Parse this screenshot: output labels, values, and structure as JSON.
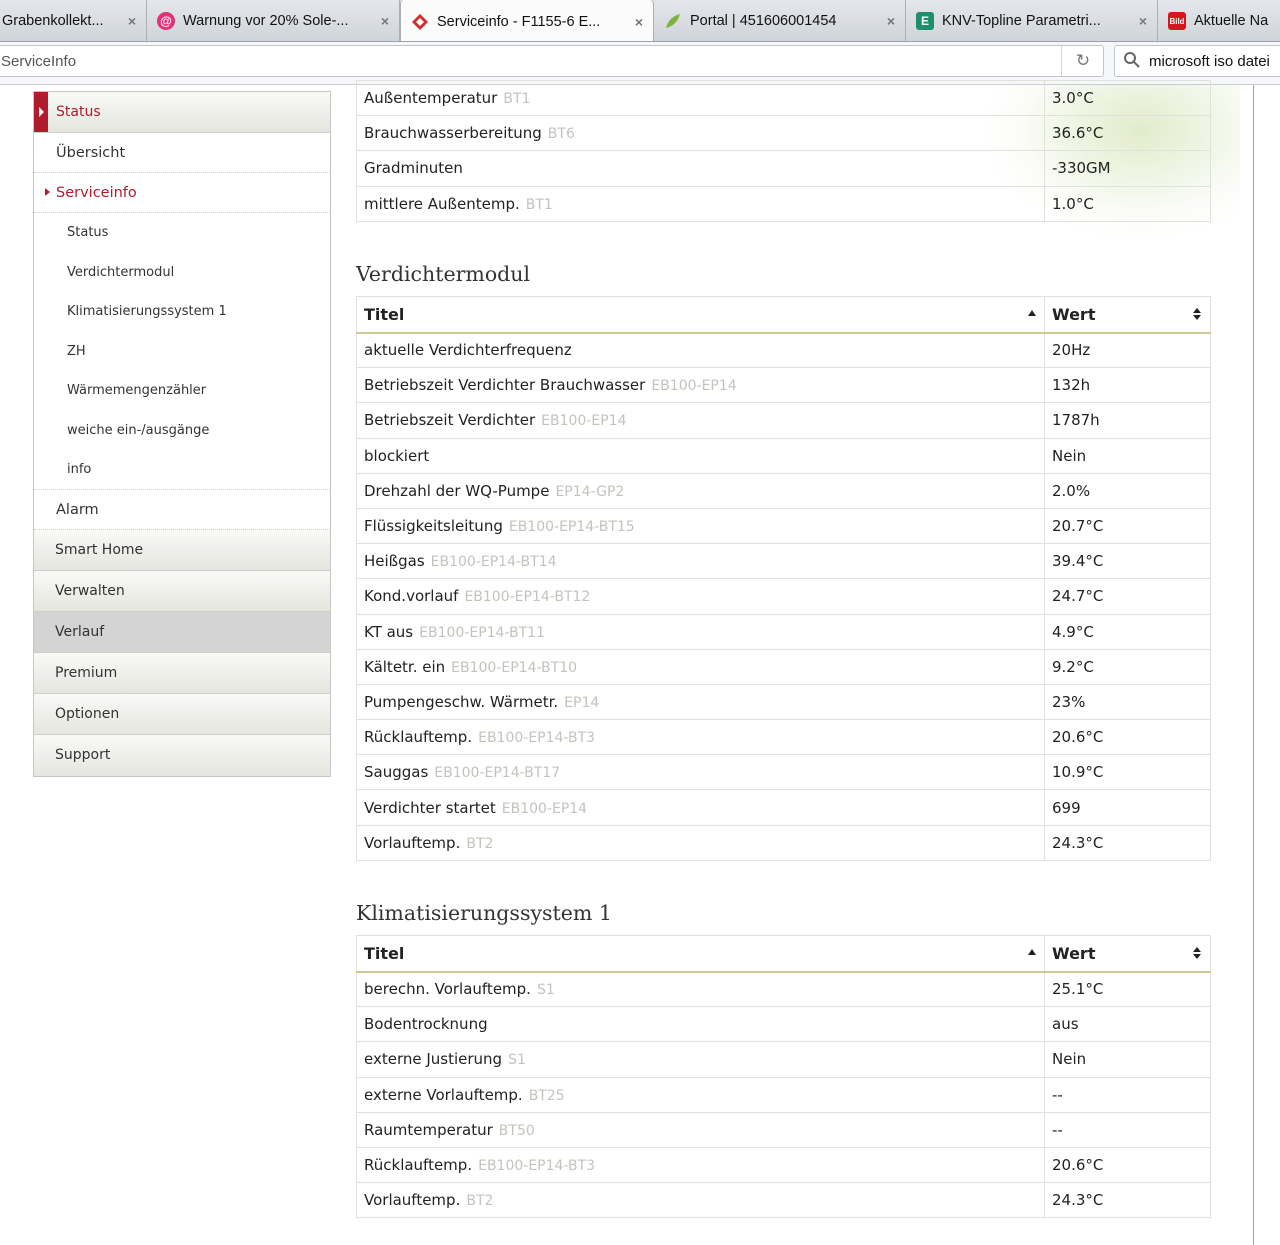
{
  "browser": {
    "tabs": [
      {
        "title": "Grabenkollekt...",
        "active": false
      },
      {
        "title": "Warnung vor 20% Sole-...",
        "active": false
      },
      {
        "title": "Serviceinfo - F1155-6 E...",
        "active": true
      },
      {
        "title": "Portal | 451606001454",
        "active": false
      },
      {
        "title": "KNV-Topline Parametri...",
        "active": false
      },
      {
        "title": "Aktuelle Na",
        "active": false
      }
    ],
    "tab_close_glyph": "×",
    "favicon_letters": {
      "knv": "E",
      "bild": "Bild"
    },
    "url": "ServiceInfo",
    "search": "microsoft iso datei"
  },
  "sidebar": {
    "status": "Status",
    "uebersicht": "Übersicht",
    "serviceinfo": "Serviceinfo",
    "sub_items": [
      "Status",
      "Verdichtermodul",
      "Klimatisierungssystem 1",
      "ZH",
      "Wärmemengenzähler",
      "weiche ein-/ausgänge",
      "info"
    ],
    "alarm": "Alarm",
    "smart_home": "Smart Home",
    "verwalten": "Verwalten",
    "verlauf": "Verlauf",
    "premium": "Premium",
    "optionen": "Optionen",
    "support": "Support"
  },
  "status_table": {
    "rows": [
      {
        "title": "Außentemperatur",
        "code": "BT1",
        "value": "3.0°C"
      },
      {
        "title": "Brauchwasserbereitung",
        "code": "BT6",
        "value": "36.6°C"
      },
      {
        "title": "Gradminuten",
        "code": "",
        "value": "-330GM"
      },
      {
        "title": "mittlere Außentemp.",
        "code": "BT1",
        "value": "1.0°C"
      }
    ]
  },
  "verdichter": {
    "heading": "Verdichtermodul",
    "col_title": "Titel",
    "col_value": "Wert",
    "rows": [
      {
        "title": "aktuelle Verdichterfrequenz",
        "code": "",
        "value": "20Hz"
      },
      {
        "title": "Betriebszeit Verdichter Brauchwasser",
        "code": "EB100-EP14",
        "value": "132h"
      },
      {
        "title": "Betriebszeit Verdichter",
        "code": "EB100-EP14",
        "value": "1787h"
      },
      {
        "title": "blockiert",
        "code": "",
        "value": "Nein"
      },
      {
        "title": "Drehzahl der WQ-Pumpe",
        "code": "EP14-GP2",
        "value": "2.0%"
      },
      {
        "title": "Flüssigkeitsleitung",
        "code": "EB100-EP14-BT15",
        "value": "20.7°C"
      },
      {
        "title": "Heißgas",
        "code": "EB100-EP14-BT14",
        "value": "39.4°C"
      },
      {
        "title": "Kond.vorlauf",
        "code": "EB100-EP14-BT12",
        "value": "24.7°C"
      },
      {
        "title": "KT aus",
        "code": "EB100-EP14-BT11",
        "value": "4.9°C"
      },
      {
        "title": "Kältetr. ein",
        "code": "EB100-EP14-BT10",
        "value": "9.2°C"
      },
      {
        "title": "Pumpengeschw. Wärmetr.",
        "code": "EP14",
        "value": "23%"
      },
      {
        "title": "Rücklauftemp.",
        "code": "EB100-EP14-BT3",
        "value": "20.6°C"
      },
      {
        "title": "Sauggas",
        "code": "EB100-EP14-BT17",
        "value": "10.9°C"
      },
      {
        "title": "Verdichter startet",
        "code": "EB100-EP14",
        "value": "699"
      },
      {
        "title": "Vorlauftemp.",
        "code": "BT2",
        "value": "24.3°C"
      }
    ]
  },
  "klima": {
    "heading": "Klimatisierungssystem 1",
    "col_title": "Titel",
    "col_value": "Wert",
    "rows": [
      {
        "title": "berechn. Vorlauftemp.",
        "code": "S1",
        "value": "25.1°C"
      },
      {
        "title": "Bodentrocknung",
        "code": "",
        "value": "aus"
      },
      {
        "title": "externe Justierung",
        "code": "S1",
        "value": "Nein"
      },
      {
        "title": "externe Vorlauftemp.",
        "code": "BT25",
        "value": "--"
      },
      {
        "title": "Raumtemperatur",
        "code": "BT50",
        "value": "--"
      },
      {
        "title": "Rücklauftemp.",
        "code": "EB100-EP14-BT3",
        "value": "20.6°C"
      },
      {
        "title": "Vorlauftemp.",
        "code": "BT2",
        "value": "24.3°C"
      }
    ]
  },
  "colors": {
    "accent_red": "#b01c2e",
    "header_rule": "#cfc995"
  }
}
